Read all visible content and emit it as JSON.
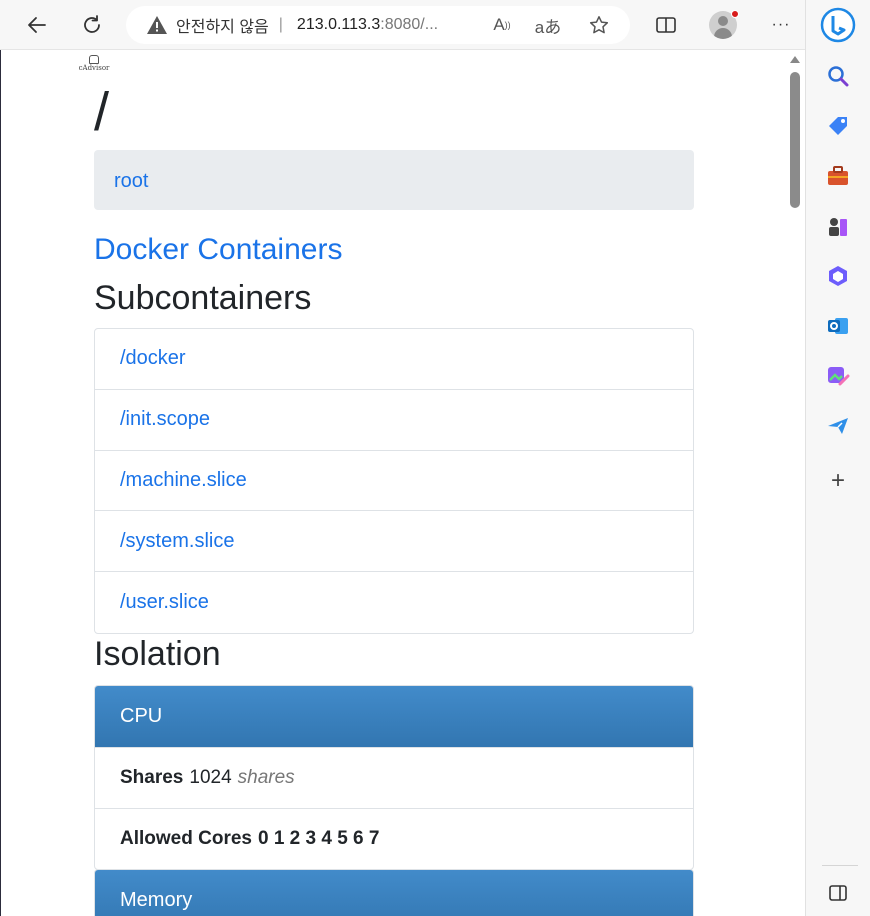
{
  "browser": {
    "address": {
      "insecure_label": "안전하지 않음",
      "separator": "|",
      "host": "213.0.113.3",
      "rest": ":8080/..."
    },
    "icons": {
      "back": "back-arrow-icon",
      "refresh": "refresh-icon",
      "read_aloud": "Aͅ",
      "translate": "aあ"
    },
    "read_aloud_label": "A",
    "translate_label": "aあ",
    "more_label": "···"
  },
  "sidebar": {
    "add_label": "+"
  },
  "page": {
    "logo_text": "cAdvisor",
    "title": "/",
    "breadcrumb": "root",
    "docker_link": "Docker Containers",
    "subcontainers_heading": "Subcontainers",
    "subcontainers": [
      "/docker",
      "/init.scope",
      "/machine.slice",
      "/system.slice",
      "/user.slice"
    ],
    "isolation_heading": "Isolation",
    "cpu": {
      "header": "CPU",
      "shares_label": "Shares",
      "shares_value": "1024",
      "shares_unit": "shares",
      "cores_label": "Allowed Cores",
      "cores_value": "0 1 2 3 4 5 6 7"
    },
    "memory": {
      "header": "Memory"
    }
  },
  "colors": {
    "link": "#1a73e8",
    "panel_header": "#3a80c0",
    "breadcrumb_bg": "#e9ecef"
  }
}
